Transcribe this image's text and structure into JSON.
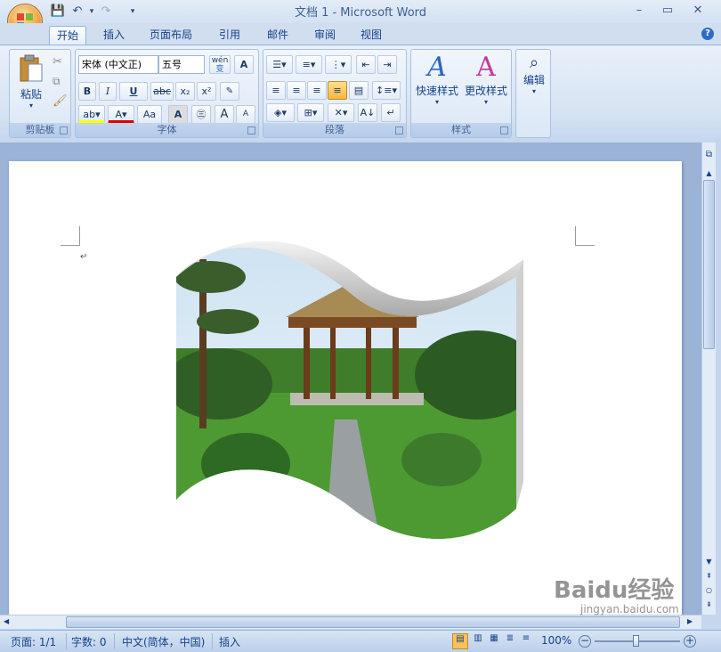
{
  "window": {
    "title": "文档 1 - Microsoft Word",
    "minimize": "–",
    "maximize": "▭",
    "close": "✕"
  },
  "qat": {
    "save": "💾",
    "undo": "↶",
    "redo": "↷",
    "more": "▾"
  },
  "tabs": [
    "开始",
    "插入",
    "页面布局",
    "引用",
    "邮件",
    "审阅",
    "视图"
  ],
  "help": "?",
  "ribbon": {
    "clipboard": {
      "label": "剪贴板",
      "paste": "粘贴"
    },
    "font": {
      "label": "字体",
      "font_name": "宋体 (中文正)",
      "font_size": "五号",
      "wen": "wén",
      "wen_char": "变",
      "A_box": "A",
      "bold": "B",
      "italic": "I",
      "underline": "U",
      "strike": "abc",
      "sub": "x₂",
      "sup": "x²",
      "aa": "Aa",
      "grow": "A",
      "shrink": "A"
    },
    "paragraph": {
      "label": "段落"
    },
    "styles": {
      "label": "样式",
      "quick": "快速样式",
      "change": "更改样式"
    },
    "edit": {
      "label": "编辑"
    }
  },
  "status": {
    "page": "页面: 1/1",
    "words": "字数: 0",
    "lang": "中文(简体，中国)",
    "mode": "插入",
    "zoom": "100%"
  },
  "watermark": {
    "main": "Baidu经验",
    "sub": "jingyan.baidu.com"
  },
  "colors": {
    "accent": "#15428b",
    "highlight": "#ffff00",
    "fontcolor": "#e00000"
  }
}
